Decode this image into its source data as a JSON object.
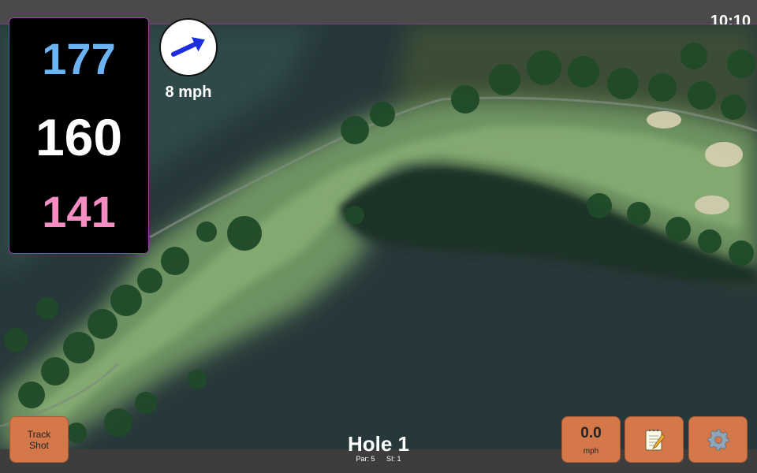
{
  "status_bar": {
    "time": "10:10"
  },
  "distances": {
    "back": "177",
    "center": "160",
    "front": "141"
  },
  "wind": {
    "speed": "8 mph",
    "direction_icon": "arrow-icon"
  },
  "hole": {
    "title": "Hole 1",
    "par": "Par: 5",
    "si": "SI: 1"
  },
  "buttons": {
    "track_shot": "Track Shot",
    "speed_value": "0.0",
    "speed_unit": "mph",
    "notes_icon": "notepad-icon",
    "settings_icon": "gear-icon"
  },
  "colors": {
    "back": "#6ab4f4",
    "center": "#ffffff",
    "front": "#f58dc2",
    "button": "#d4784a",
    "accent": "#9b3fa8",
    "wind_arrow": "#1a2ee0"
  }
}
